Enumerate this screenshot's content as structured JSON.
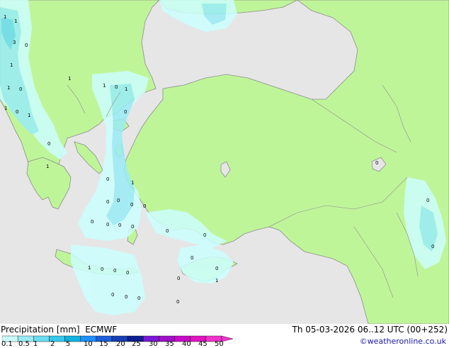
{
  "legend": {
    "title": "Precipitation [mm]",
    "model": "ECMWF",
    "ticks": [
      "0.1",
      "0.5",
      "1",
      "2",
      "5",
      "10",
      "15",
      "20",
      "25",
      "30",
      "35",
      "40",
      "45",
      "50"
    ],
    "colors": [
      "#ccffff",
      "#99ecf6",
      "#6bdcf0",
      "#38c9ea",
      "#12b2e0",
      "#1e90ff",
      "#1e5fd7",
      "#1a3fb4",
      "#0d1f90",
      "#7a18d6",
      "#a10ec8",
      "#c80ac8",
      "#e014c0",
      "#f032cc"
    ]
  },
  "run": {
    "text": "Th 05-03-2026 06..12 UTC (00+252)"
  },
  "credit": "©weatheronline.co.uk",
  "map": {
    "colors": {
      "sea": "#e6e6e6",
      "land": "#bff599",
      "border": "#8c8c8c"
    },
    "markers": [
      "1",
      "1",
      "3",
      "0",
      "1",
      "1",
      "0",
      "0",
      "1",
      "1",
      "0",
      "1",
      "1",
      "1",
      "0",
      "1",
      "0",
      "0",
      "1",
      "0",
      "0",
      "0",
      "0",
      "0",
      "0",
      "0",
      "0",
      "0",
      "0",
      "1",
      "0",
      "0",
      "0",
      "1",
      "0",
      "0",
      "0",
      "0",
      "0",
      "0",
      "0",
      "0",
      "0",
      "0"
    ]
  }
}
